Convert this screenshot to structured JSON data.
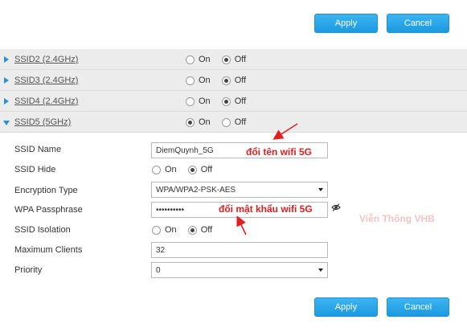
{
  "buttons": {
    "apply": "Apply",
    "cancel": "Cancel"
  },
  "ssid_rows": [
    {
      "name": "SSID2 (2.4GHz)",
      "on_label": "On",
      "off_label": "Off",
      "selected": "off"
    },
    {
      "name": "SSID3 (2.4GHz)",
      "on_label": "On",
      "off_label": "Off",
      "selected": "off"
    },
    {
      "name": "SSID4 (2.4GHz)",
      "on_label": "On",
      "off_label": "Off",
      "selected": "off"
    },
    {
      "name": "SSID5 (5GHz)",
      "on_label": "On",
      "off_label": "Off",
      "selected": "on"
    }
  ],
  "form": {
    "ssid_name": {
      "label": "SSID Name",
      "value": "DiemQuynh_5G"
    },
    "ssid_hide": {
      "label": "SSID Hide",
      "on_label": "On",
      "off_label": "Off",
      "selected": "off"
    },
    "encryption": {
      "label": "Encryption Type",
      "value": "WPA/WPA2-PSK-AES"
    },
    "passphrase": {
      "label": "WPA Passphrase",
      "value": "••••••••••"
    },
    "isolation": {
      "label": "SSID Isolation",
      "on_label": "On",
      "off_label": "Off",
      "selected": "off"
    },
    "max_clients": {
      "label": "Maximum Clients",
      "value": "32"
    },
    "priority": {
      "label": "Priority",
      "value": "0"
    }
  },
  "annotations": {
    "rename": "đổi tên wifi 5G",
    "password": "đổi mật khẩu wifi 5G",
    "color": "#e02020"
  },
  "watermark": "Viễn Thông VHB",
  "colors": {
    "accent": "#1a9ae0",
    "row_bg": "#ececec"
  }
}
